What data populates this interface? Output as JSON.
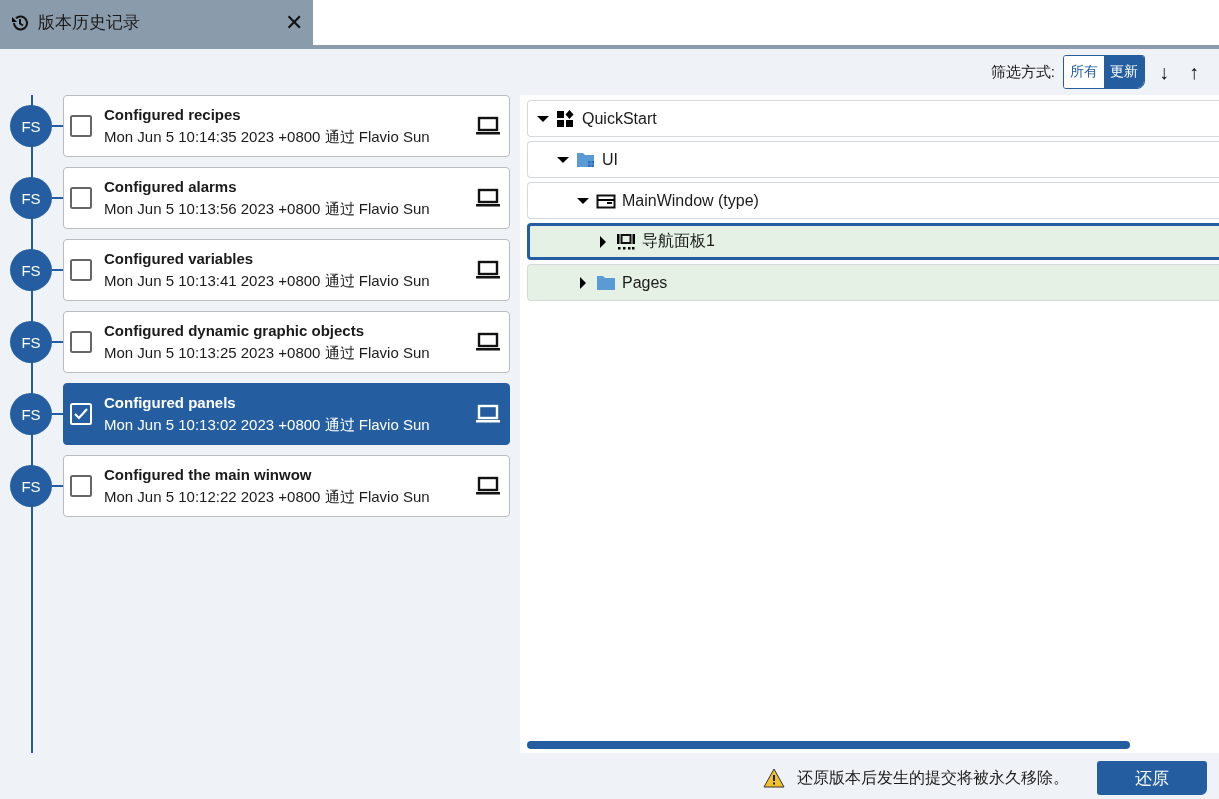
{
  "tab": {
    "title": "版本历史记录",
    "close": "✕"
  },
  "filter": {
    "label": "筛选方式:",
    "options": [
      {
        "label": "所有",
        "selected": false
      },
      {
        "label": "更新",
        "selected": true
      }
    ],
    "sort_down": "↓",
    "sort_up": "↑"
  },
  "commits": [
    {
      "avatar": "FS",
      "title": "Configured recipes",
      "meta": "Mon Jun 5 10:14:35 2023 +0800 通过 Flavio Sun",
      "selected": false
    },
    {
      "avatar": "FS",
      "title": "Configured alarms",
      "meta": "Mon Jun 5 10:13:56 2023 +0800 通过 Flavio Sun",
      "selected": false
    },
    {
      "avatar": "FS",
      "title": "Configured variables",
      "meta": "Mon Jun 5 10:13:41 2023 +0800 通过 Flavio Sun",
      "selected": false
    },
    {
      "avatar": "FS",
      "title": "Configured dynamic graphic objects",
      "meta": "Mon Jun 5 10:13:25 2023 +0800 通过 Flavio Sun",
      "selected": false
    },
    {
      "avatar": "FS",
      "title": "Configured panels",
      "meta": "Mon Jun 5 10:13:02 2023 +0800 通过 Flavio Sun",
      "selected": true
    },
    {
      "avatar": "FS",
      "title": "Configured the main winwow",
      "meta": "Mon Jun 5 10:12:22 2023 +0800 通过 Flavio Sun",
      "selected": false
    }
  ],
  "tree": [
    {
      "label": "QuickStart",
      "kind": "project",
      "expanded": true,
      "changed": false,
      "selected": false,
      "children": [
        {
          "label": "UI",
          "kind": "ui-folder",
          "expanded": true,
          "changed": false,
          "selected": false,
          "children": [
            {
              "label": "MainWindow (type)",
              "kind": "window",
              "expanded": true,
              "changed": false,
              "selected": false,
              "children": [
                {
                  "label": "导航面板1",
                  "kind": "panel",
                  "expanded": false,
                  "changed": true,
                  "selected": true
                }
              ]
            },
            {
              "label": "Pages",
              "kind": "folder",
              "expanded": false,
              "changed": true,
              "selected": false
            }
          ]
        }
      ]
    }
  ],
  "footer": {
    "warning": "还原版本后发生的提交将被永久移除。",
    "button": "还原"
  }
}
